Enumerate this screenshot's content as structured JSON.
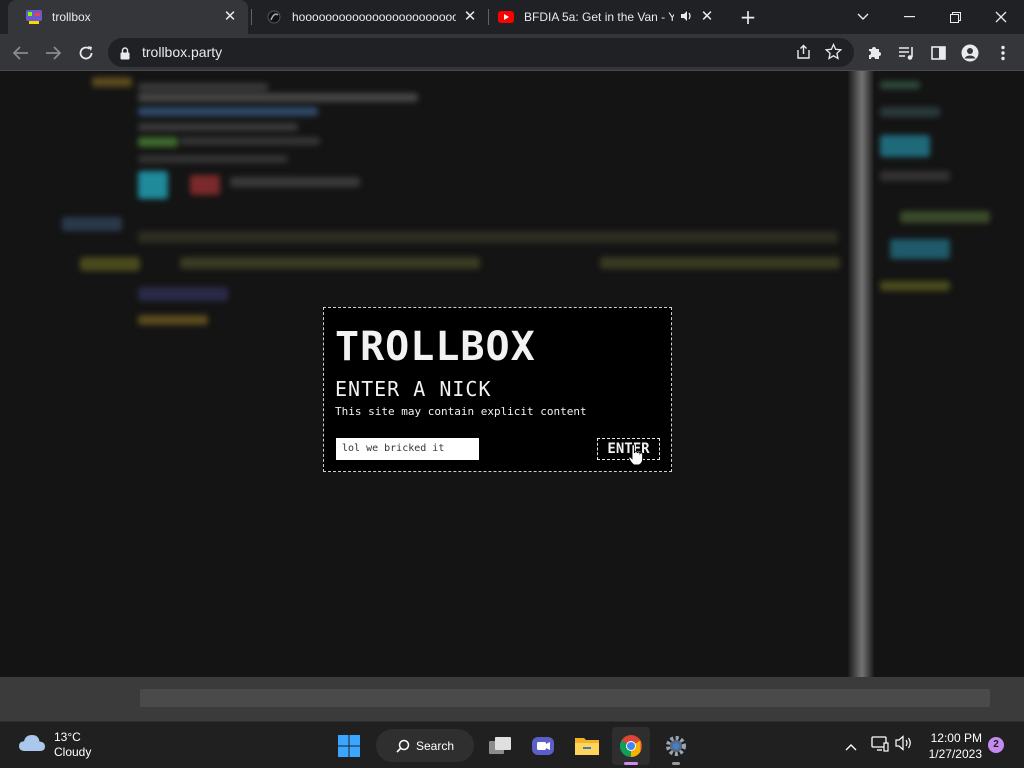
{
  "browser": {
    "tabs": [
      {
        "title": "trollbox",
        "active": true,
        "favicon": "trollbox-favicon"
      },
      {
        "title": "hoooooooooooooooooooooooooooooo",
        "active": false,
        "favicon": "hooo-favicon"
      },
      {
        "title": "BFDIA 5a: Get in the Van - YouTube",
        "active": false,
        "favicon": "youtube-favicon",
        "audio": "speaker-icon"
      }
    ],
    "url": "trollbox.party",
    "colors": {
      "frame": "#202124",
      "toolbar": "#35363a",
      "omnibox": "#202124"
    }
  },
  "dialog": {
    "brand": "TROLLBOX",
    "heading": "ENTER A NICK",
    "warning": "This site may contain explicit content",
    "nick_value": "lol we bricked it",
    "enter_label": "ENTER"
  },
  "taskbar": {
    "weather": {
      "temp": "13°C",
      "condition": "Cloudy",
      "icon": "cloud-icon"
    },
    "search_label": "Search",
    "apps": [
      "start-icon",
      "task-view-icon",
      "meet-icon",
      "file-explorer-icon",
      "chrome-icon",
      "settings-icon"
    ],
    "clock": {
      "time": "12:00 PM",
      "date": "1/27/2023"
    },
    "notification_count": "2"
  }
}
